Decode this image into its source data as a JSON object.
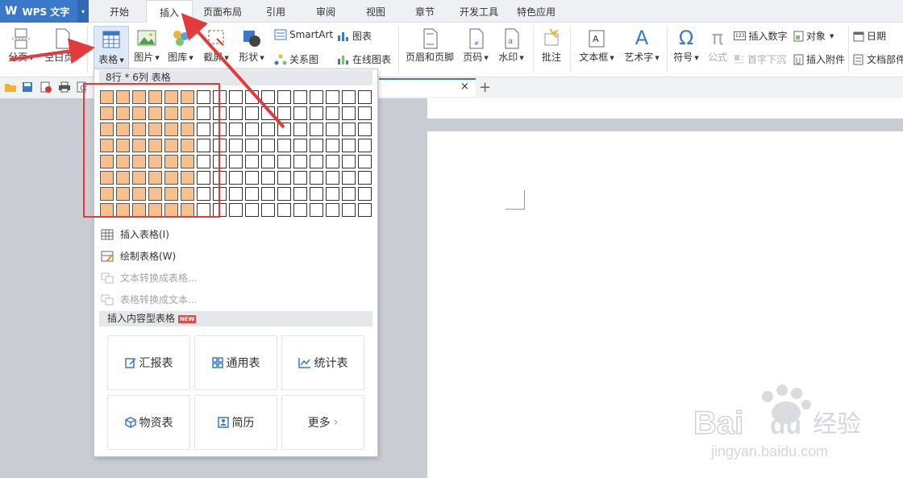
{
  "app": {
    "logo_mark": "W",
    "name": "WPS 文字",
    "dropdown_glyph": "▾"
  },
  "tabs": [
    {
      "label": "开始"
    },
    {
      "label": "插入"
    },
    {
      "label": "页面布局"
    },
    {
      "label": "引用"
    },
    {
      "label": "审阅"
    },
    {
      "label": "视图"
    },
    {
      "label": "章节"
    },
    {
      "label": "开发工具"
    },
    {
      "label": "特色应用"
    }
  ],
  "active_tab": "插入",
  "ribbon": {
    "page_break": "分页",
    "blank_page": "空白页",
    "table": "表格",
    "picture": "图片",
    "gallery": "图库",
    "screenshot": "截屏",
    "shapes": "形状",
    "smartart": "SmartArt",
    "chart": "图表",
    "relation_chart": "关系图",
    "online_chart": "在线图表",
    "header_footer": "页眉和页脚",
    "page_number": "页码",
    "watermark": "水印",
    "comment": "批注",
    "textbox": "文本框",
    "wordart": "艺术字",
    "symbol": "符号",
    "formula": "公式",
    "insert_number": "插入数字",
    "number_badge": "123",
    "drop_cap": "首字下沉",
    "object": "对象",
    "insert_attachment": "插入附件",
    "date": "日期",
    "doc_parts": "文档部件",
    "symbol_glyph": "Ω",
    "formula_glyph": "π",
    "wordart_glyph": "A"
  },
  "table_picker": {
    "header": "8行 * 6列 表格",
    "rows": 8,
    "cols": 17,
    "selected_rows": 8,
    "selected_cols": 6
  },
  "menu": {
    "insert_table": "插入表格(I)",
    "draw_table": "绘制表格(W)",
    "text_to_table": "文本转换成表格...",
    "table_to_text": "表格转换成文本..."
  },
  "content_tables": {
    "header": "插入内容型表格",
    "badge": "NEW",
    "cards": [
      {
        "label": "汇报表"
      },
      {
        "label": "通用表"
      },
      {
        "label": "统计表"
      },
      {
        "label": "物资表"
      },
      {
        "label": "简历"
      },
      {
        "label": "更多"
      }
    ],
    "more_glyph": "›"
  },
  "document": {
    "tab_close": "×",
    "new_tab": "+"
  },
  "watermark": {
    "brand_latin": "Bai",
    "brand_du": "du",
    "brand_cn": "经验",
    "url": "jingyan.baidu.com"
  },
  "colors": {
    "accent": "#3a78c9",
    "selected_cell": "#fbbf8b",
    "arrow_red": "#e23b3b",
    "highlight_box": "#e23b3b"
  }
}
